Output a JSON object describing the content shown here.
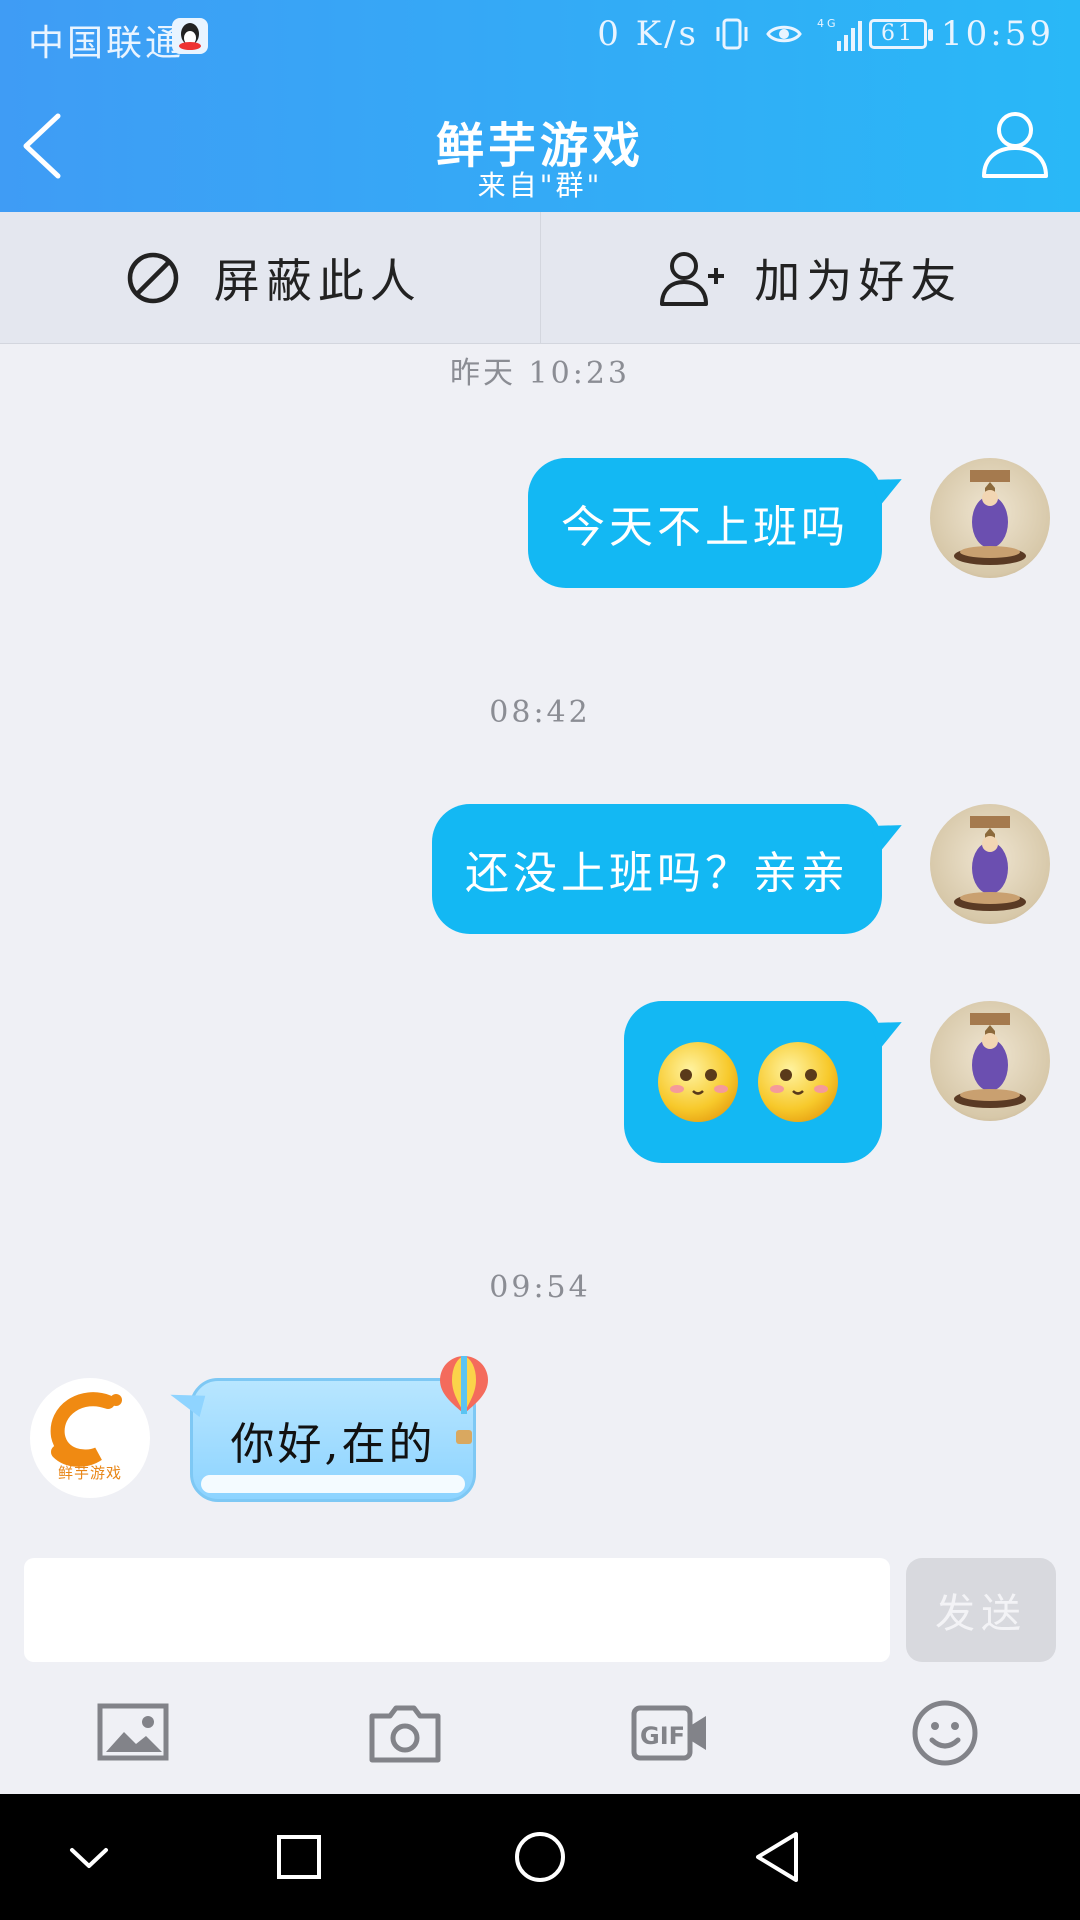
{
  "status_bar": {
    "carrier": "中国联通",
    "net_speed": "0 K/s",
    "signal_type": "4G",
    "battery": "61",
    "time": "10:59"
  },
  "header": {
    "title": "鲜芋游戏",
    "subtitle": "来自\"群\""
  },
  "actions": {
    "block_label": "屏蔽此人",
    "add_friend_label": "加为好友"
  },
  "chat": {
    "timestamps": [
      "昨天 10:23",
      "08:42",
      "09:54"
    ],
    "messages": [
      {
        "side": "out",
        "text": "今天不上班吗"
      },
      {
        "side": "out",
        "text": "还没上班吗？亲亲"
      },
      {
        "side": "out",
        "emoji": "smile-face-emoji"
      },
      {
        "side": "in",
        "text": "你好,在的"
      }
    ],
    "contact_logo_text": "鲜芋游戏"
  },
  "input": {
    "placeholder": "",
    "send_label": "发送"
  },
  "toolbar": {
    "items": [
      "image-icon",
      "camera-icon",
      "gif-icon",
      "emoji-icon"
    ]
  },
  "colors": {
    "header_start": "#3f9cf5",
    "header_end": "#29b8f7",
    "bubble_out": "#13b8f3",
    "bubble_in": "#b8e6ff",
    "background": "#eff0f5"
  }
}
